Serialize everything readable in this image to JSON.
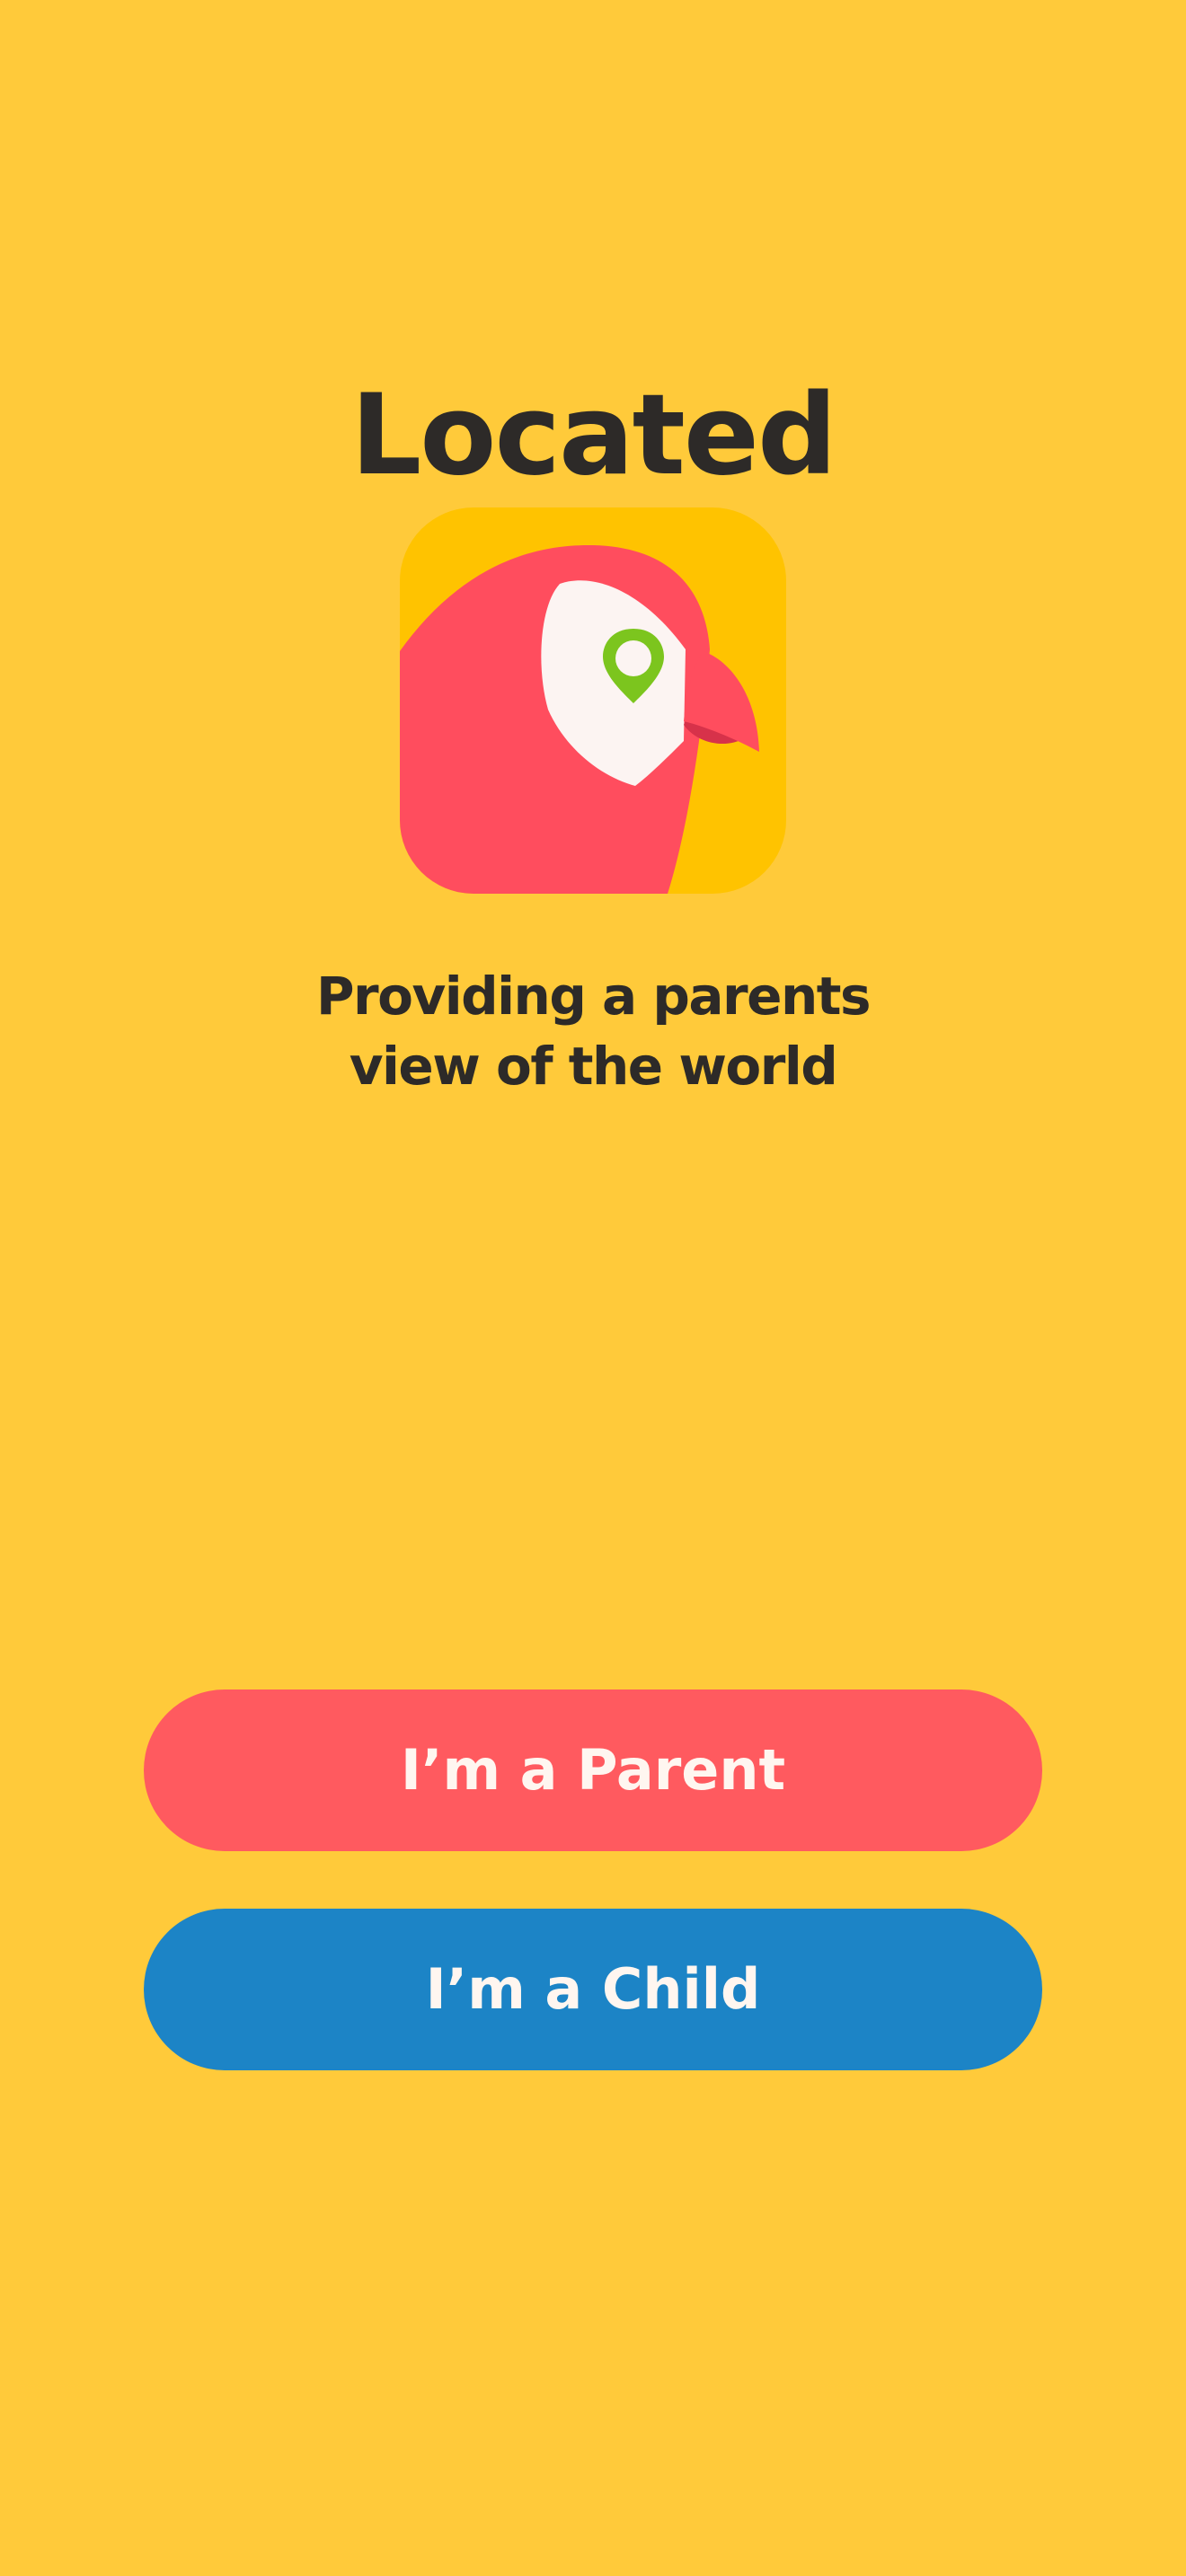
{
  "app": {
    "title": "Located",
    "tagline_line1": "Providing a parents",
    "tagline_line2": "view of the world",
    "logo_icon": "parrot-location-pin-icon"
  },
  "actions": {
    "parent_label": "I’m a Parent",
    "child_label": "I’m a Child"
  },
  "colors": {
    "background": "#FFCA3A",
    "logo_background": "#FFC300",
    "parrot_body": "#FF4D5E",
    "parent_button": "#FF5A5F",
    "child_button": "#1C84C6",
    "pin": "#7CC51E",
    "text_dark": "#2D2A28",
    "button_text": "#FFF6F0"
  }
}
